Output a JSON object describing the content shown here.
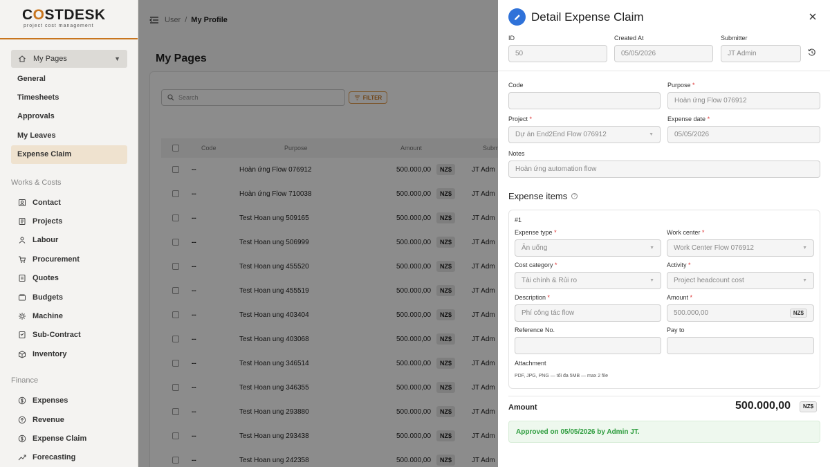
{
  "logo": {
    "main_a": "C",
    "main_o": "O",
    "main_b": "STDESK",
    "sub": "project cost management"
  },
  "sidebar": {
    "top_item": "My Pages",
    "pages": [
      {
        "label": "General"
      },
      {
        "label": "Timesheets"
      },
      {
        "label": "Approvals"
      },
      {
        "label": "My Leaves"
      },
      {
        "label": "Expense Claim"
      }
    ],
    "works_title": "Works & Costs",
    "works": [
      {
        "label": "Contact",
        "icon": "contact-icon"
      },
      {
        "label": "Projects",
        "icon": "projects-icon"
      },
      {
        "label": "Labour",
        "icon": "labour-icon"
      },
      {
        "label": "Procurement",
        "icon": "cart-icon"
      },
      {
        "label": "Quotes",
        "icon": "quotes-icon"
      },
      {
        "label": "Budgets",
        "icon": "budgets-icon"
      },
      {
        "label": "Machine",
        "icon": "machine-icon"
      },
      {
        "label": "Sub-Contract",
        "icon": "subcontract-icon"
      },
      {
        "label": "Inventory",
        "icon": "inventory-icon"
      }
    ],
    "finance_title": "Finance",
    "finance": [
      {
        "label": "Expenses",
        "icon": "dollar-icon"
      },
      {
        "label": "Revenue",
        "icon": "revenue-icon"
      },
      {
        "label": "Expense Claim",
        "icon": "dollar-icon"
      },
      {
        "label": "Forecasting",
        "icon": "trend-icon"
      }
    ]
  },
  "breadcrumb": {
    "parent": "User",
    "sep": "/",
    "current": "My Profile"
  },
  "main": {
    "title": "My Pages",
    "search_placeholder": "Search",
    "filter_label": "FILTER",
    "columns": {
      "code": "Code",
      "purpose": "Purpose",
      "amount": "Amount",
      "submitter": "Subm"
    },
    "rows": [
      {
        "code": "--",
        "purpose": "Hoàn ứng Flow 076912",
        "amount": "500.000,00",
        "currency": "NZ$",
        "submitter": "JT Adm"
      },
      {
        "code": "--",
        "purpose": "Hoàn ứng Flow 710038",
        "amount": "500.000,00",
        "currency": "NZ$",
        "submitter": "JT Adm"
      },
      {
        "code": "--",
        "purpose": "Test Hoan ung 509165",
        "amount": "500.000,00",
        "currency": "NZ$",
        "submitter": "JT Adm"
      },
      {
        "code": "--",
        "purpose": "Test Hoan ung 506999",
        "amount": "500.000,00",
        "currency": "NZ$",
        "submitter": "JT Adm"
      },
      {
        "code": "--",
        "purpose": "Test Hoan ung 455520",
        "amount": "500.000,00",
        "currency": "NZ$",
        "submitter": "JT Adm"
      },
      {
        "code": "--",
        "purpose": "Test Hoan ung 455519",
        "amount": "500.000,00",
        "currency": "NZ$",
        "submitter": "JT Adm"
      },
      {
        "code": "--",
        "purpose": "Test Hoan ung 403404",
        "amount": "500.000,00",
        "currency": "NZ$",
        "submitter": "JT Adm"
      },
      {
        "code": "--",
        "purpose": "Test Hoan ung 403068",
        "amount": "500.000,00",
        "currency": "NZ$",
        "submitter": "JT Adm"
      },
      {
        "code": "--",
        "purpose": "Test Hoan ung 346514",
        "amount": "500.000,00",
        "currency": "NZ$",
        "submitter": "JT Adm"
      },
      {
        "code": "--",
        "purpose": "Test Hoan ung 346355",
        "amount": "500.000,00",
        "currency": "NZ$",
        "submitter": "JT Adm"
      },
      {
        "code": "--",
        "purpose": "Test Hoan ung 293880",
        "amount": "500.000,00",
        "currency": "NZ$",
        "submitter": "JT Adm"
      },
      {
        "code": "--",
        "purpose": "Test Hoan ung 293438",
        "amount": "500.000,00",
        "currency": "NZ$",
        "submitter": "JT Adm"
      },
      {
        "code": "--",
        "purpose": "Test Hoan ung 242358",
        "amount": "500.000,00",
        "currency": "NZ$",
        "submitter": "JT Adm"
      }
    ]
  },
  "drawer": {
    "title": "Detail Expense Claim",
    "id_label": "ID",
    "id_value": "50",
    "created_label": "Created At",
    "created_value": "05/05/2026",
    "submitter_label": "Submitter",
    "submitter_value": "JT Admin",
    "code_label": "Code",
    "code_value": "",
    "purpose_label": "Purpose",
    "purpose_value": "Hoàn ứng Flow 076912",
    "project_label": "Project",
    "project_value": "Dự án End2End Flow 076912",
    "date_label": "Expense date",
    "date_value": "05/05/2026",
    "notes_label": "Notes",
    "notes_value": "Hoàn ứng automation flow",
    "items_title": "Expense items",
    "help_glyph": "?",
    "req_mark": "*",
    "item": {
      "number": "#1",
      "type_label": "Expense type",
      "type_value": "Ăn uống",
      "wc_label": "Work center",
      "wc_value": "Work Center Flow 076912",
      "cat_label": "Cost category",
      "cat_value": "Tài chính & Rủi ro",
      "act_label": "Activity",
      "act_value": "Project headcount cost",
      "desc_label": "Description",
      "desc_value": "Phí công tác flow",
      "amt_label": "Amount",
      "amt_value": "500.000,00",
      "amt_currency": "NZ$",
      "ref_label": "Reference No.",
      "ref_value": "",
      "pay_label": "Pay to",
      "pay_value": "",
      "att_label": "Attachment",
      "att_hint": "PDF, JPG, PNG — tối đa 5MB — max 2 file"
    },
    "total_label": "Amount",
    "total_value": "500.000,00",
    "total_currency": "NZ$",
    "approved_text": "Approved on 05/05/2026 by Admin JT."
  },
  "colors": {
    "accent": "#c8751e",
    "primary": "#2f72d9",
    "success": "#2e9d3e"
  }
}
